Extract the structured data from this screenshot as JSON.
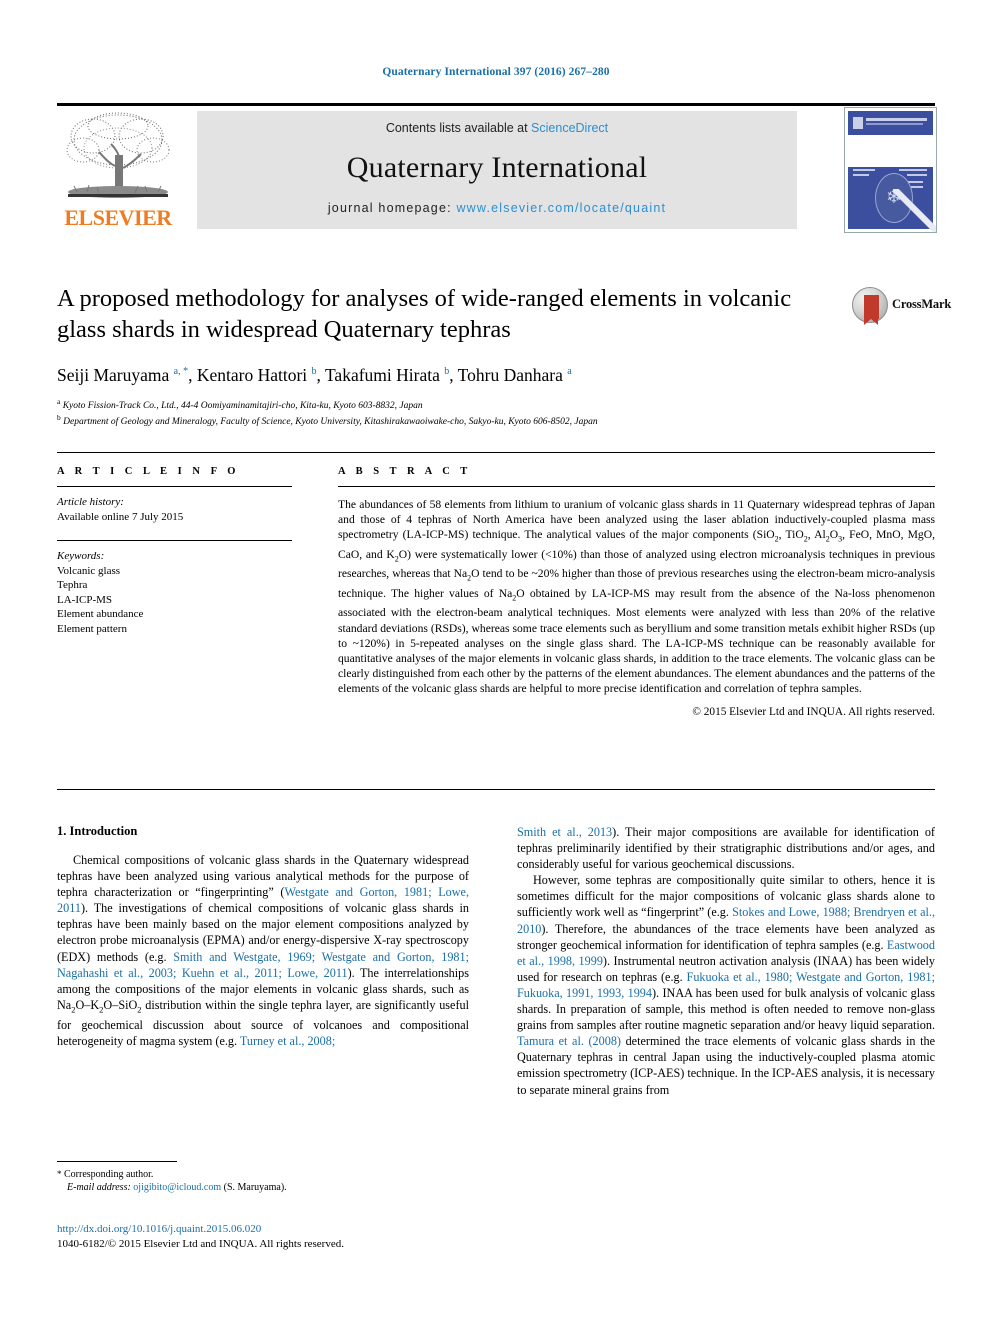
{
  "running_head": "Quaternary International 397 (2016) 267–280",
  "masthead": {
    "contents_prefix": "Contents lists available at ",
    "sciencedirect": "ScienceDirect",
    "journal_title": "Quaternary International",
    "homepage_prefix": "journal homepage: ",
    "homepage_url": "www.elsevier.com/locate/quaint",
    "publisher_name": "ELSEVIER",
    "cover_alt": "Quaternary International cover"
  },
  "crossmark": {
    "label": "CrossMark"
  },
  "article": {
    "title": "A proposed methodology for analyses of wide-ranged elements in volcanic glass shards in widespread Quaternary tephras",
    "authors_html": "Seiji Maruyama <sup>a, *</sup>, Kentaro Hattori <sup>b</sup>, Takafumi Hirata <sup>b</sup>, Tohru Danhara <sup>a</sup>",
    "affiliation_a": "Kyoto Fission-Track Co., Ltd., 44-4 Oomiyaminamitajiri-cho, Kita-ku, Kyoto 603-8832, Japan",
    "affiliation_b": "Department of Geology and Mineralogy, Faculty of Science, Kyoto University, Kitashirakawaoiwake-cho, Sakyo-ku, Kyoto 606-8502, Japan"
  },
  "article_info": {
    "heading": "A R T I C L E  I N F O",
    "history_label": "Article history:",
    "history_value": "Available online 7 July 2015",
    "keywords_label": "Keywords:",
    "keywords": [
      "Volcanic glass",
      "Tephra",
      "LA-ICP-MS",
      "Element abundance",
      "Element pattern"
    ]
  },
  "abstract": {
    "heading": "A B S T R A C T",
    "body_html": "The abundances of 58 elements from lithium to uranium of volcanic glass shards in 11 Quaternary widespread tephras of Japan and those of 4 tephras of North America have been analyzed using the laser ablation inductively-coupled plasma mass spectrometry (LA-ICP-MS) technique. The analytical values of the major components (SiO<sub>2</sub>, TiO<sub>2</sub>, Al<sub>2</sub>O<sub>3</sub>, FeO, MnO, MgO, CaO, and K<sub>2</sub>O) were systematically lower (&lt;10%) than those of analyzed using electron microanalysis techniques in previous researches, whereas that Na<sub>2</sub>O tend to be ~20% higher than those of previous researches using the electron-beam micro-analysis technique. The higher values of Na<sub>2</sub>O obtained by LA-ICP-MS may result from the absence of the Na-loss phenomenon associated with the electron-beam analytical techniques. Most elements were analyzed with less than 20% of the relative standard deviations (RSDs), whereas some trace elements such as beryllium and some transition metals exhibit higher RSDs (up to ~120%) in 5-repeated analyses on the single glass shard. The LA-ICP-MS technique can be reasonably available for quantitative analyses of the major elements in volcanic glass shards, in addition to the trace elements. The volcanic glass can be clearly distinguished from each other by the patterns of the element abundances. The element abundances and the patterns of the elements of the volcanic glass shards are helpful to more precise identification and correlation of tephra samples.",
    "copyright": "© 2015 Elsevier Ltd and INQUA. All rights reserved."
  },
  "introduction": {
    "section_title": "1. Introduction",
    "left_paragraph_html": "Chemical compositions of volcanic glass shards in the Quaternary widespread tephras have been analyzed using various analytical methods for the purpose of tephra characterization or “fingerprinting” (<span class=\"ref\">Westgate and Gorton, 1981; Lowe, 2011</span>). The investigations of chemical compositions of volcanic glass shards in tephras have been mainly based on the major element compositions analyzed by electron probe microanalysis (EPMA) and/or energy-dispersive X-ray spectroscopy (EDX) methods (e.g. <span class=\"ref\">Smith and Westgate, 1969; Westgate and Gorton, 1981; Nagahashi et al., 2003; Kuehn et al., 2011; Lowe, 2011</span>). The interrelationships among the compositions of the major elements in volcanic glass shards, such as Na<sub>2</sub>O–K<sub>2</sub>O–SiO<sub>2</sub> distribution within the single tephra layer, are significantly useful for geochemical discussion about source of volcanoes and compositional heterogeneity of magma system (e.g. <span class=\"ref\">Turney et al., 2008;</span>",
    "right_paragraph_1_html": "<span class=\"ref\">Smith et al., 2013</span>). Their major compositions are available for identification of tephras preliminarily identified by their stratigraphic distributions and/or ages, and considerably useful for various geochemical discussions.",
    "right_paragraph_2_html": "However, some tephras are compositionally quite similar to others, hence it is sometimes difficult for the major compositions of volcanic glass shards alone to sufficiently work well as “fingerprint” (e.g. <span class=\"ref\">Stokes and Lowe, 1988; Brendryen et al., 2010</span>). Therefore, the abundances of the trace elements have been analyzed as stronger geochemical information for identification of tephra samples (e.g. <span class=\"ref\">Eastwood et al., 1998, 1999</span>). Instrumental neutron activation analysis (INAA) has been widely used for research on tephras (e.g. <span class=\"ref\">Fukuoka et al., 1980; Westgate and Gorton, 1981; Fukuoka, 1991, 1993, 1994</span>). INAA has been used for bulk analysis of volcanic glass shards. In preparation of sample, this method is often needed to remove non-glass grains from samples after routine magnetic separation and/or heavy liquid separation. <span class=\"ref\">Tamura et al. (2008)</span> determined the trace elements of volcanic glass shards in the Quaternary tephras in central Japan using the inductively-coupled plasma atomic emission spectrometry (ICP-AES) technique. In the ICP-AES analysis, it is necessary to separate mineral grains from"
  },
  "footnote": {
    "star": "*",
    "corresponding": "Corresponding author.",
    "email_label": "E-mail address:",
    "email": "ojigibito@icloud.com",
    "email_owner": "(S. Maruyama)."
  },
  "footer": {
    "doi": "http://dx.doi.org/10.1016/j.quaint.2015.06.020",
    "issn_line": "1040-6182/© 2015 Elsevier Ltd and INQUA. All rights reserved."
  },
  "colors": {
    "link_blue": "#1a6fa8",
    "sd_blue": "#2b8fd0",
    "elsevier_orange": "#ef7c22",
    "masthead_grey": "#e3e3e3",
    "crossmark_red": "#c0392b"
  }
}
